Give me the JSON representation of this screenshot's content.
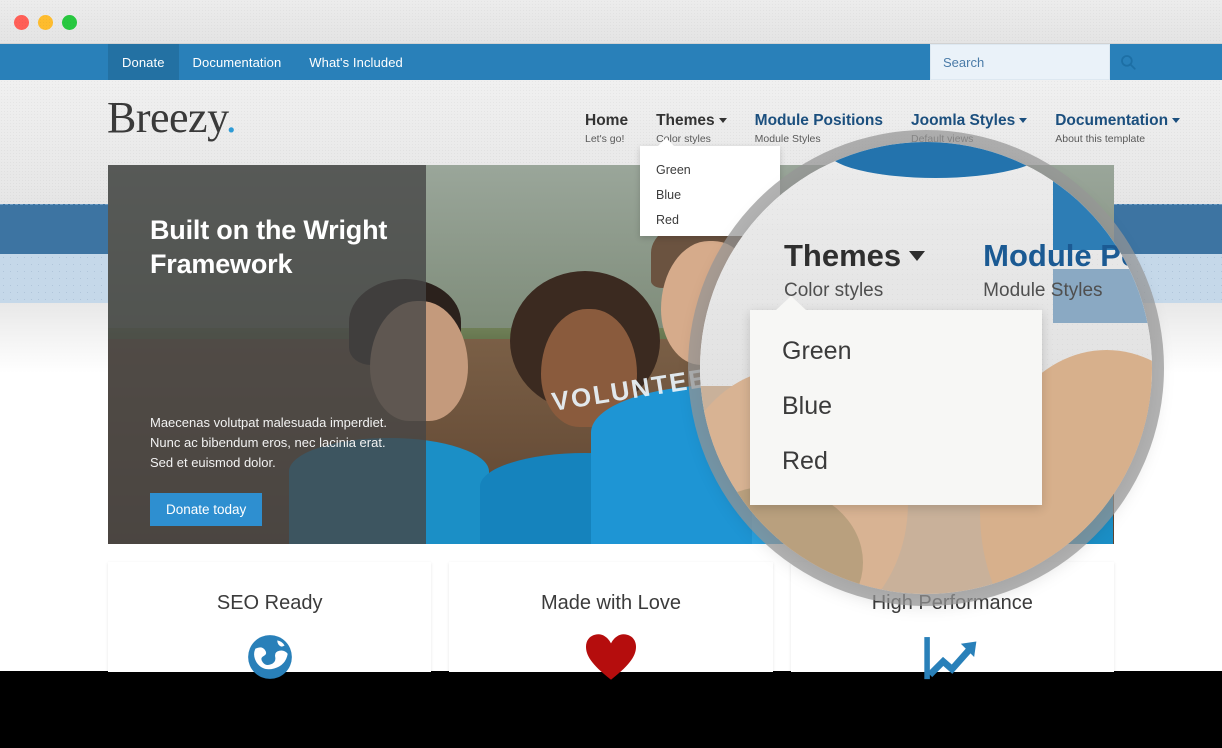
{
  "window": {
    "traffic_lights": [
      {
        "name": "close",
        "color": "#ff5f57"
      },
      {
        "name": "minimize",
        "color": "#febc2e"
      },
      {
        "name": "zoom",
        "color": "#28c840"
      }
    ]
  },
  "topbar": {
    "background": "#2980b9",
    "items": [
      {
        "label": "Donate",
        "active": true
      },
      {
        "label": "Documentation",
        "active": false
      },
      {
        "label": "What's Included",
        "active": false
      }
    ]
  },
  "search": {
    "placeholder": "Search",
    "value": "",
    "icon": "search-icon"
  },
  "brand": {
    "name": "Breezy",
    "dot": ".",
    "dot_color": "#2e9bd6"
  },
  "mainnav": {
    "items": [
      {
        "title": "Home",
        "sub": "Let's go!",
        "caret": false,
        "style": "dark"
      },
      {
        "title": "Themes",
        "sub": "Color styles",
        "caret": true,
        "style": "dark"
      },
      {
        "title": "Module Positions",
        "sub": "Module Styles",
        "caret": false,
        "style": "blue"
      },
      {
        "title": "Joomla Styles",
        "sub": "Default views",
        "caret": true,
        "style": "blue"
      },
      {
        "title": "Documentation",
        "sub": "About this template",
        "caret": true,
        "style": "blue"
      }
    ]
  },
  "dropdown": {
    "open_for": "Themes",
    "items": [
      {
        "label": "Green"
      },
      {
        "label": "Blue"
      },
      {
        "label": "Red"
      }
    ]
  },
  "hero": {
    "title": "Built on the Wright Framework",
    "body": "Maecenas volutpat malesuada imperdiet. Nunc ac bibendum eros, nec lacinia erat. Sed et euismod dolor.",
    "button_label": "Donate today",
    "button_color": "#2e8fd0",
    "shirt_text": "VOLUNTEER"
  },
  "cards": [
    {
      "title": "SEO Ready",
      "icon": "globe-icon",
      "icon_color": "#2980b9"
    },
    {
      "title": "Made with Love",
      "icon": "heart-icon",
      "icon_color": "#b50d0d"
    },
    {
      "title": "High Performance",
      "icon": "line-chart-icon",
      "icon_color": "#2980b9"
    }
  ],
  "magnifier": {
    "nav": [
      {
        "title": "Themes",
        "sub": "Color styles",
        "caret": true,
        "style": "dark"
      },
      {
        "title": "Module Po",
        "sub": "Module Styles",
        "caret": false,
        "style": "blue"
      }
    ],
    "dropdown_items": [
      {
        "label": "Green"
      },
      {
        "label": "Blue"
      },
      {
        "label": "Red"
      }
    ]
  }
}
